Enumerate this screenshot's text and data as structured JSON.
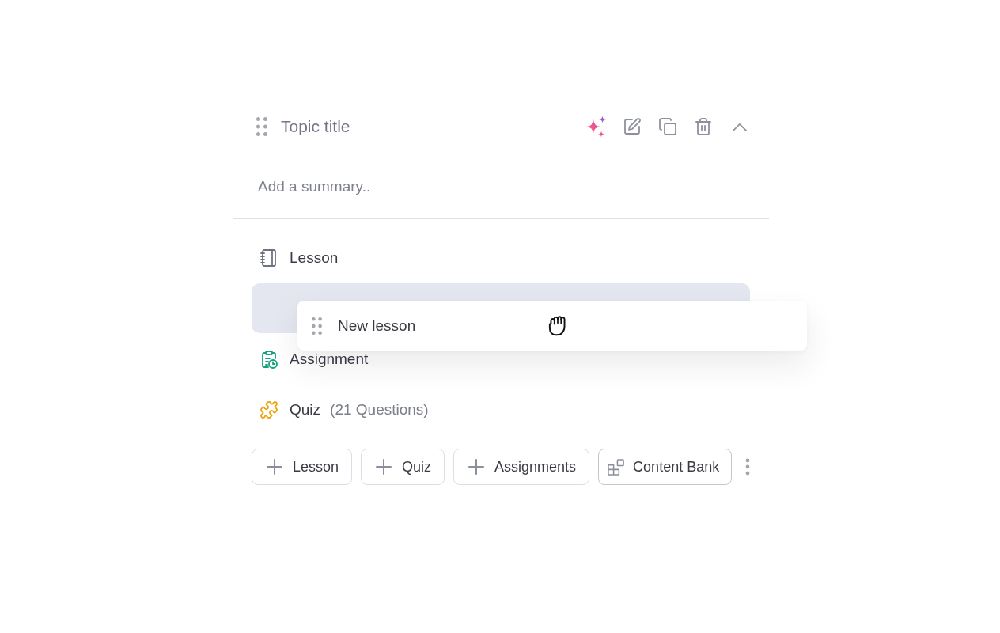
{
  "topic": {
    "title": "Topic title",
    "summary": {
      "placeholder": "Add a summary.."
    }
  },
  "contents": [
    {
      "kind": "lesson",
      "title": "Lesson"
    },
    {
      "kind": "drop_slot"
    },
    {
      "kind": "assignment",
      "title": "Assignment"
    },
    {
      "kind": "quiz",
      "title": "Quiz",
      "detail": "(21 Questions)"
    }
  ],
  "dragged_item": {
    "title": "New lesson"
  },
  "add_buttons": [
    {
      "kind": "add",
      "label": "Lesson"
    },
    {
      "kind": "add",
      "label": "Quiz"
    },
    {
      "kind": "add",
      "label": "Assignments"
    },
    {
      "kind": "bank",
      "label": "Content Bank"
    }
  ]
}
